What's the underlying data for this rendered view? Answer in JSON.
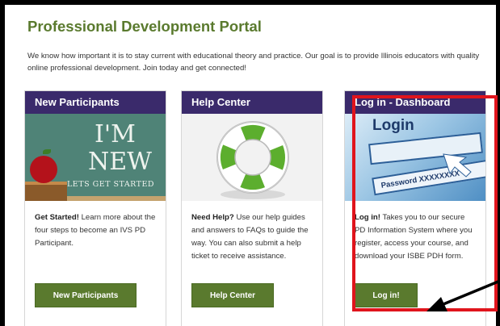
{
  "portal": {
    "title": "Professional Development Portal",
    "intro": "We know how important it is to stay current with educational theory and practice. Our goal is to provide Illinois educators with quality online professional development. Join today and get connected!"
  },
  "cards": [
    {
      "header": "New Participants",
      "image_text": [
        "I'M",
        "NEW",
        "LETS GET STARTED"
      ],
      "lead": "Get Started!",
      "body": " Learn more about the four steps to become an IVS PD Participant.",
      "button": "New Participants"
    },
    {
      "header": "Help Center",
      "lead": "Need Help?",
      "body": " Use our help guides and answers to FAQs to guide the way. You can also submit a help ticket to receive assistance.",
      "button": "Help Center"
    },
    {
      "header": "Log in - Dashboard",
      "image_text": [
        "Login",
        "Password XXXXXXXX"
      ],
      "lead": "Log in!",
      "body": " Takes you to our secure PD Information System where you register, access your course, and download your ISBE PDH form.",
      "button": "Log in!"
    }
  ],
  "colors": {
    "title_green": "#5a7a2e",
    "header_purple": "#3a2a6b",
    "button_green": "#5a7a2e",
    "highlight_red": "#e0141c"
  },
  "icons": {
    "lifebuoy": "lifebuoy-icon",
    "apple": "apple-icon",
    "annotation_arrow": "arrow-icon"
  }
}
